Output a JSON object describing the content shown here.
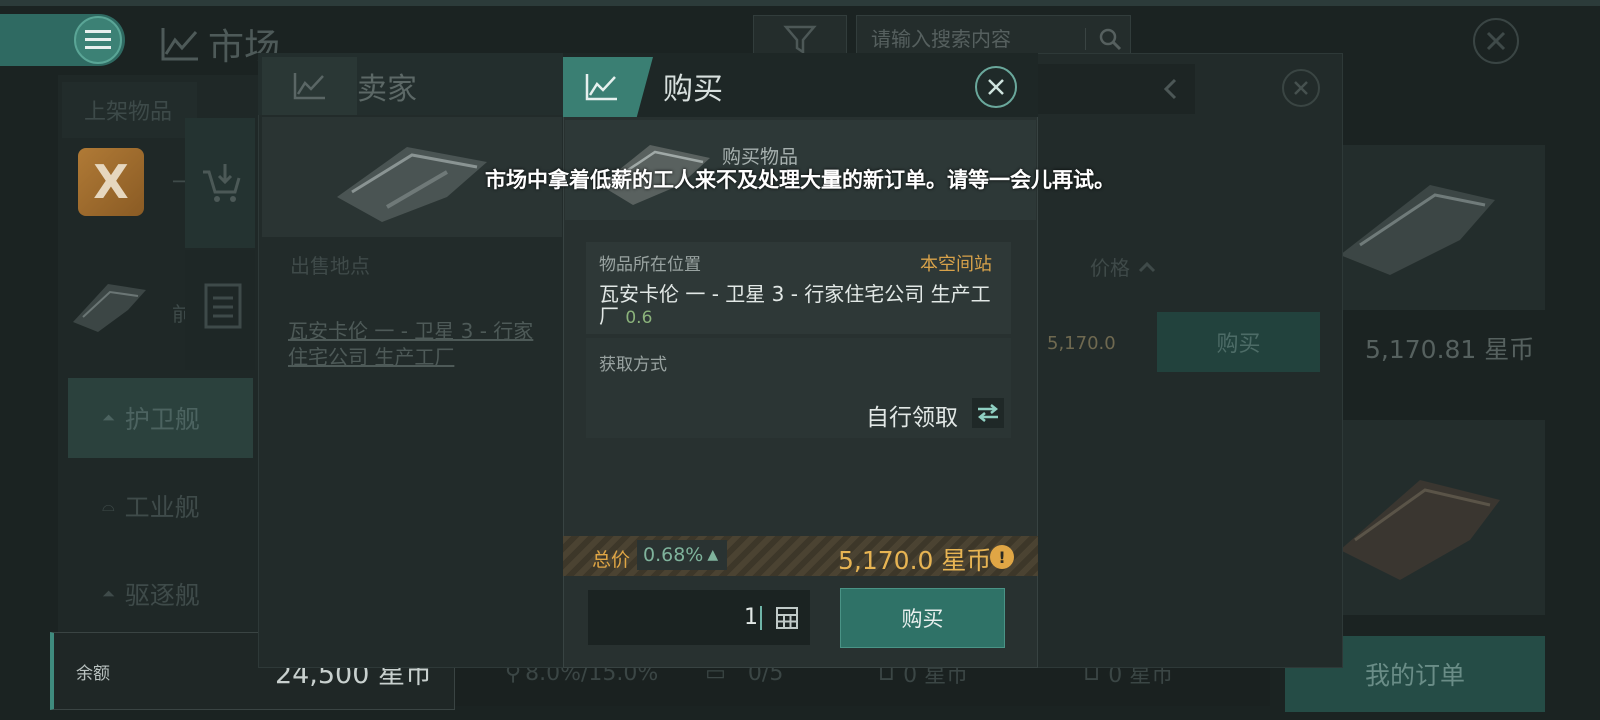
{
  "background": {
    "title": "市场",
    "search_placeholder": "请输入搜索内容",
    "listed_items_header": "上架物品",
    "listed_item_prefix": "一",
    "listed_item2_prefix": "前",
    "categories": [
      {
        "label": "护卫舰",
        "active": true
      },
      {
        "label": "工业舰",
        "active": false
      },
      {
        "label": "驱逐舰",
        "active": false
      }
    ],
    "balance_label": "余额",
    "balance_value": "24,500 星币",
    "bottom_stats": {
      "tax": "8.0%/15.0%",
      "orders": "0/5",
      "buy_total": "0 星币",
      "sell_total": "0 星币"
    },
    "my_orders_label": "我的订单",
    "right_price": "5,170.81 星币"
  },
  "seller_dialog": {
    "title": "卖家",
    "col_location": "出售地点",
    "col_price": "价格",
    "row_location": "瓦安卡伦 一 - 卫星 3 - 行家住宅公司 生产工厂",
    "row_price": "5,170.0",
    "row_buy_label": "购买"
  },
  "buy_dialog": {
    "title": "购买",
    "item_label": "购买物品",
    "toast": "市场中拿着低薪的工人来不及处理大量的新订单。请等一会儿再试。",
    "location_label": "物品所在位置",
    "location_tag": "本空间站",
    "location_name": "瓦安卡伦 一 - 卫星 3 - 行家住宅公司 生产工厂",
    "location_security": "0.6",
    "acquire_label": "获取方式",
    "acquire_value": "自行领取",
    "total_label": "总价",
    "total_pct": "0.68%",
    "total_value": "5,170.0 星币",
    "quantity": "1",
    "buy_button": "购买"
  },
  "colors": {
    "accent": "#3a7f73",
    "gold": "#e0a645",
    "background": "#1b2322"
  }
}
